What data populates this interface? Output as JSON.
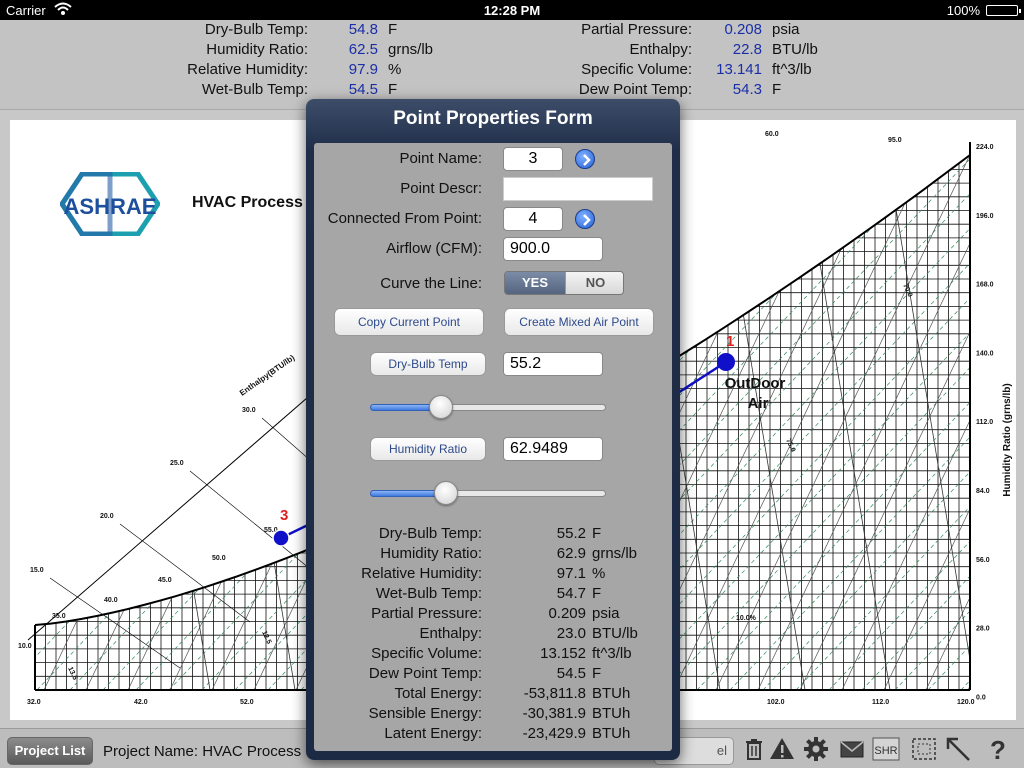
{
  "status_bar": {
    "carrier": "Carrier",
    "time": "12:28 PM",
    "battery": "100%"
  },
  "readout": {
    "left": [
      {
        "label": "Dry-Bulb Temp:",
        "value": "54.8",
        "unit": "F"
      },
      {
        "label": "Humidity Ratio:",
        "value": "62.5",
        "unit": "grns/lb"
      },
      {
        "label": "Relative Humidity:",
        "value": "97.9",
        "unit": "%"
      },
      {
        "label": "Wet-Bulb Temp:",
        "value": "54.5",
        "unit": "F"
      }
    ],
    "right": [
      {
        "label": "Partial Pressure:",
        "value": "0.208",
        "unit": "psia"
      },
      {
        "label": "Enthalpy:",
        "value": "22.8",
        "unit": "BTU/lb"
      },
      {
        "label": "Specific Volume:",
        "value": "13.141",
        "unit": "ft^3/lb"
      },
      {
        "label": "Dew Point Temp:",
        "value": "54.3",
        "unit": "F"
      }
    ]
  },
  "chart": {
    "logo_text": "ASHRAE",
    "title": "HVAC Process",
    "enthalpy_axis_label": "Enthalpy(BTU/lb)",
    "humidity_axis_label": "Humidity Ratio (grns/lb)",
    "right_ticks": [
      "224.0",
      "196.0",
      "168.0",
      "140.0",
      "112.0",
      "84.0",
      "56.0",
      "28.0",
      "0.0"
    ],
    "bottom_ticks": [
      "32.0",
      "42.0",
      "52.0",
      "102.0",
      "112.0",
      "120.0"
    ],
    "top_ticks": [
      "60.0",
      "95.0"
    ],
    "enthalpy_ticks": [
      "30.0",
      "25.0",
      "20.0",
      "15.0",
      "10.0"
    ],
    "saturation_ticks": [
      "55.0",
      "50.0",
      "45.0",
      "40.0",
      "35.0"
    ],
    "misc_labels": [
      "70.0",
      "10.0",
      "75.0",
      "13.5",
      "12.5",
      "10.0%"
    ],
    "points": [
      {
        "number": "1",
        "name_line1": "OutDoor",
        "name_line2": "Air"
      },
      {
        "number": "3"
      }
    ],
    "colors": {
      "point": "#1010c8",
      "point_number": "#dd2020",
      "grid": "#111111",
      "guide": "#2e8b57"
    }
  },
  "modal": {
    "title": "Point Properties Form",
    "point_name_label": "Point Name:",
    "point_name_value": "3",
    "point_descr_label": "Point Descr:",
    "point_descr_value": "",
    "connected_from_label": "Connected From Point:",
    "connected_from_value": "4",
    "airflow_label": "Airflow (CFM):",
    "airflow_value": "900.0",
    "curve_label": "Curve the Line:",
    "curve_yes": "YES",
    "curve_no": "NO",
    "curve_selected": "YES",
    "copy_button": "Copy Current Point",
    "mixed_air_button": "Create Mixed Air Point",
    "drybulb_button": "Dry-Bulb Temp",
    "drybulb_value": "55.2",
    "drybulb_slider": 0.28,
    "humidity_button": "Humidity Ratio",
    "humidity_value": "62.9489",
    "humidity_slider": 0.3,
    "results": [
      {
        "label": "Dry-Bulb Temp:",
        "value": "55.2",
        "unit": "F"
      },
      {
        "label": "Humidity Ratio:",
        "value": "62.9",
        "unit": "grns/lb"
      },
      {
        "label": "Relative Humidity:",
        "value": "97.1",
        "unit": "%"
      },
      {
        "label": "Wet-Bulb Temp:",
        "value": "54.7",
        "unit": "F"
      },
      {
        "label": "Partial Pressure:",
        "value": "0.209",
        "unit": "psia"
      },
      {
        "label": "Enthalpy:",
        "value": "23.0",
        "unit": "BTU/lb"
      },
      {
        "label": "Specific Volume:",
        "value": "13.152",
        "unit": "ft^3/lb"
      },
      {
        "label": "Dew Point Temp:",
        "value": "54.5",
        "unit": "F"
      },
      {
        "label": "Total Energy:",
        "value": "-53,811.8",
        "unit": "BTUh"
      },
      {
        "label": "Sensible Energy:",
        "value": "-30,381.9",
        "unit": "BTUh"
      },
      {
        "label": "Latent Energy:",
        "value": "-23,429.9",
        "unit": "BTUh"
      }
    ]
  },
  "toolbar": {
    "project_list": "Project List",
    "project_name": "Project Name: HVAC Process",
    "partial_button": "el",
    "icons": [
      "trash-icon",
      "warning-icon",
      "gear-icon",
      "mail-icon",
      "shr-icon",
      "select-region-icon",
      "line-arrow-icon",
      "help-icon"
    ],
    "shr_label": "SHR",
    "help_label": "?"
  }
}
